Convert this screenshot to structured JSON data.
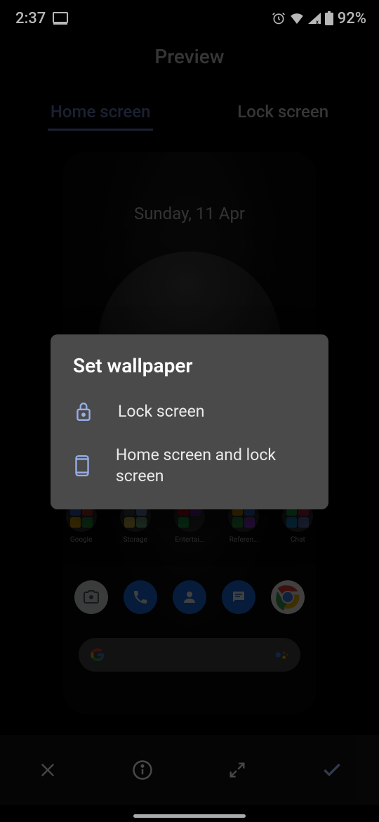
{
  "status": {
    "time": "2:37",
    "battery": "92%"
  },
  "page": {
    "title": "Preview"
  },
  "tabs": {
    "home": "Home screen",
    "lock": "Lock screen"
  },
  "preview": {
    "date": "Sunday, 11 Apr",
    "folders": [
      {
        "label": "Google"
      },
      {
        "label": "Storage"
      },
      {
        "label": "Entertai…"
      },
      {
        "label": "Referen…"
      },
      {
        "label": "Chat"
      }
    ]
  },
  "bottom_actions": {
    "cancel": "Cancel",
    "info": "Info",
    "expand": "Expand",
    "confirm": "Confirm"
  },
  "dialog": {
    "title": "Set wallpaper",
    "option_lock": "Lock screen",
    "option_both": "Home screen and lock screen"
  },
  "colors": {
    "accent": "#6d87c9",
    "dialog_bg": "#4a4a4a",
    "icon_accent": "#97aee6"
  }
}
